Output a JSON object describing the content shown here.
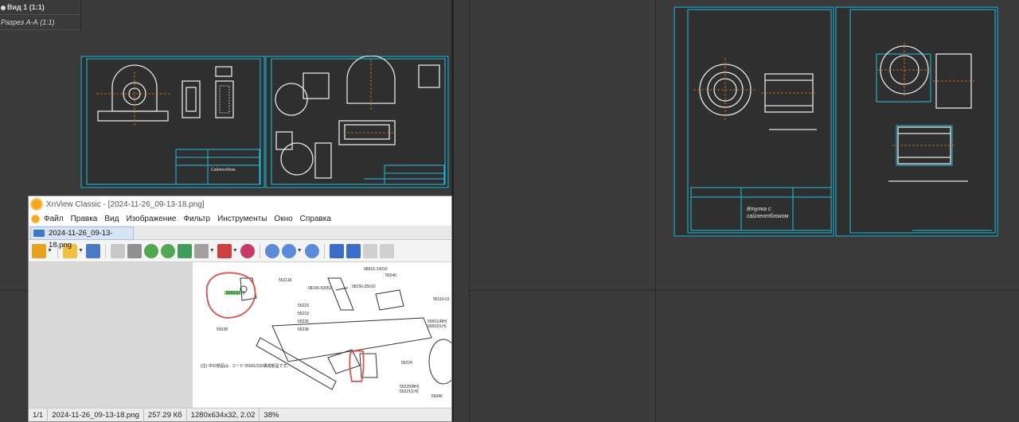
{
  "tree": {
    "view1": "Вид 1 (1:1)",
    "section": "Разрез А-А (1:1)"
  },
  "drawing_right": {
    "title_block_text": "Втулка с сайлентблоком"
  },
  "xnview": {
    "title": "XnView Classic - [2024-11-26_09-13-18.png]",
    "menu": [
      "Файл",
      "Правка",
      "Вид",
      "Изображение",
      "Фильтр",
      "Инструменты",
      "Окно",
      "Справка"
    ],
    "tab": "2024-11-26_09-13-18.png",
    "status": {
      "page": "1/1",
      "filename": "2024-11-26_09-13-18.png",
      "size": "257.29 Кб",
      "dims": "1280x634x32, 2.02",
      "zoom": "38%"
    },
    "parts": [
      "55211K",
      "08915-14210",
      "08156-62052",
      "55240",
      "08156-25610",
      "55223",
      "55219",
      "55226",
      "55238",
      "55110-01",
      "55501(RH)",
      "55502(LH)",
      "55038",
      "55220(RH)",
      "55221(LH)",
      "55046",
      "55224"
    ],
    "note": "(注) 中の部品は.. コード 55501/2の構成部品です。"
  },
  "colors": {
    "cad_line": "#1ec0e0",
    "cad_white": "#e6e6e6",
    "cad_orange": "#e07a1a",
    "highlight_red": "#d9534f"
  }
}
